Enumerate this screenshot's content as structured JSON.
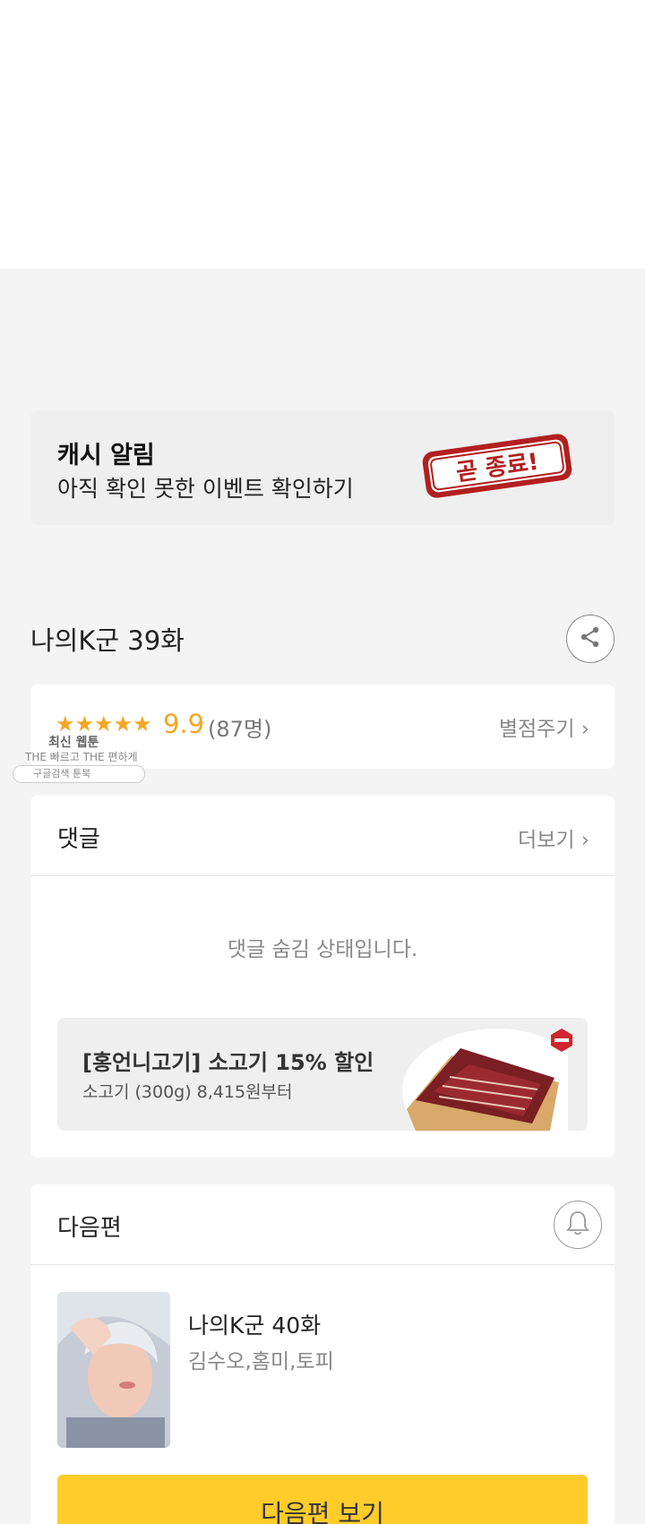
{
  "cash_banner": {
    "title": "캐시 알림",
    "subtitle": "아직 확인 못한 이벤트 확인하기",
    "stamp_text": "곧 종료!"
  },
  "episode": {
    "title": "나의K군 39화",
    "share_icon": "share-icon"
  },
  "rating": {
    "stars": "★★★★★",
    "star_count": 5,
    "score": "9.9",
    "count": "(87명)",
    "rate_label": "별점주기",
    "chevron": "›",
    "star_color": "#f5a623"
  },
  "watermark": {
    "line1": "최신 웹툰",
    "line2": "THE 빠르고 THE 편하게",
    "pill": "구글검색   툰북"
  },
  "comments": {
    "title": "댓글",
    "more_label": "더보기",
    "chevron": "›",
    "hidden_message": "댓글 숨김 상태입니다."
  },
  "ad": {
    "title": "[홍언니고기] 소고기 15% 할인",
    "subtitle": "소고기 (300g) 8,415원부터"
  },
  "next": {
    "title": "다음편",
    "bell_icon": "bell-icon",
    "episode_title": "나의K군 40화",
    "authors": "김수오,홈미,토피",
    "button_label": "다음편 보기",
    "button_color": "#ffcc2a"
  }
}
